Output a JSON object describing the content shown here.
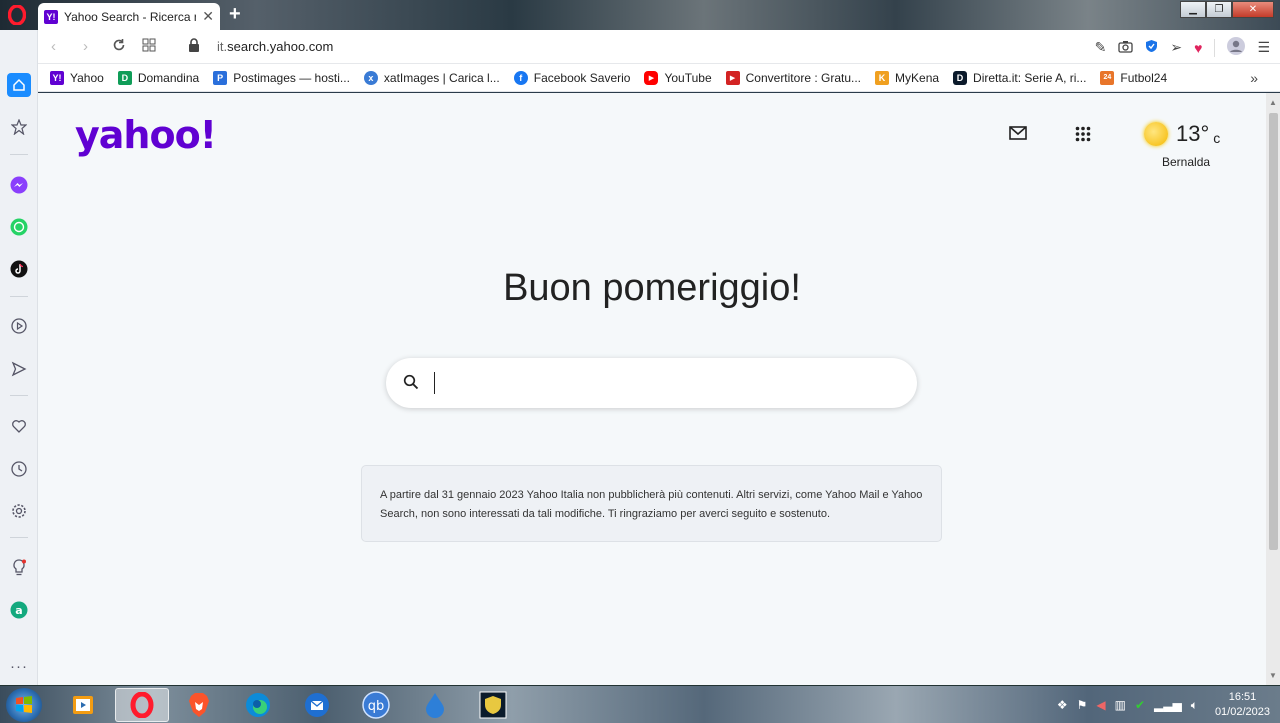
{
  "browser": {
    "tab": {
      "title": "Yahoo Search - Ricerca nel",
      "favicon": "Y!"
    },
    "address": {
      "url_prefix": "it.",
      "url_main": "search.yahoo.com"
    },
    "bookmarks": [
      {
        "label": "Yahoo",
        "icon": "yahoo-icon",
        "color": "#6001d2",
        "glyph": "Y!"
      },
      {
        "label": "Domandina",
        "icon": "domandina-icon",
        "color": "#0f9d58",
        "glyph": "D"
      },
      {
        "label": "Postimages — hosti...",
        "icon": "postimages-icon",
        "color": "#2a6fdb",
        "glyph": "P"
      },
      {
        "label": "xatImages | Carica l...",
        "icon": "xatimages-icon",
        "color": "#3a7bd5",
        "glyph": "x"
      },
      {
        "label": "Facebook Saverio",
        "icon": "facebook-icon",
        "color": "#1877f2",
        "glyph": "f"
      },
      {
        "label": "YouTube",
        "icon": "youtube-icon",
        "color": "#ff0000",
        "glyph": "▶"
      },
      {
        "label": "Convertitore : Gratu...",
        "icon": "convertitore-icon",
        "color": "#d32323",
        "glyph": "▶"
      },
      {
        "label": "MyKena",
        "icon": "mykena-icon",
        "color": "#f0a020",
        "glyph": "K"
      },
      {
        "label": "Diretta.it: Serie A, ri...",
        "icon": "diretta-icon",
        "color": "#0b1a2b",
        "glyph": "D"
      },
      {
        "label": "Futbol24",
        "icon": "futbol24-icon",
        "color": "#e8752a",
        "glyph": "24"
      }
    ]
  },
  "yahoo": {
    "logo": "yahoo!",
    "weather": {
      "temp": "13°",
      "unit": "c",
      "city": "Bernalda"
    },
    "greeting": "Buon pomeriggio!",
    "search_placeholder": "",
    "notice": "A partire dal 31 gennaio 2023 Yahoo Italia non pubblicherà più contenuti. Altri servizi, come Yahoo Mail e Yahoo Search, non sono interessati da tali modifiche. Ti ringraziamo per averci seguito e sostenuto."
  },
  "taskbar": {
    "clock_time": "16:51",
    "clock_date": "01/02/2023"
  },
  "colors": {
    "brand": "#6001d2",
    "page_bg": "#f5f8fa"
  }
}
